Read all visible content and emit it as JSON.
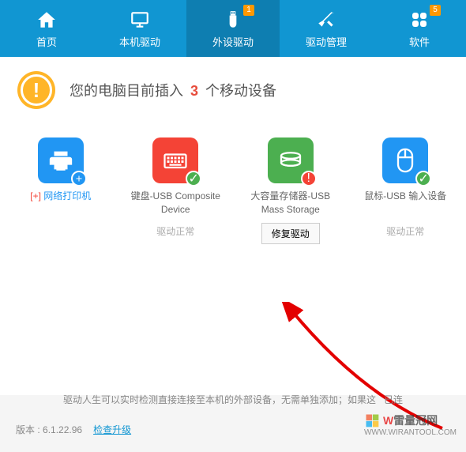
{
  "nav": {
    "items": [
      {
        "label": "首页",
        "badge": null
      },
      {
        "label": "本机驱动",
        "badge": null
      },
      {
        "label": "外设驱动",
        "badge": "1"
      },
      {
        "label": "驱动管理",
        "badge": null
      },
      {
        "label": "软件",
        "badge": "5"
      }
    ]
  },
  "alert": {
    "prefix": "您的电脑目前插入 ",
    "count": "3",
    "suffix": " 个移动设备"
  },
  "devices": [
    {
      "name": "网络打印机",
      "status": "",
      "action": ""
    },
    {
      "name": "键盘-USB Composite Device",
      "status": "驱动正常",
      "action": ""
    },
    {
      "name": "大容量存储器-USB Mass Storage",
      "status": "",
      "action": "修复驱动"
    },
    {
      "name": "鼠标-USB 输入设备",
      "status": "驱动正常",
      "action": ""
    }
  ],
  "footer": {
    "tip": "驱动人生可以实时检测直接连接至本机的外部设备，无需单独添加；如果这",
    "tip_suffix": "已连",
    "version_label": "版本 : ",
    "version": "6.1.22.96",
    "check": "检查升级"
  },
  "watermark": {
    "brand_prefix": "W",
    "brand": "雷量冠网",
    "url": "WWW.WIRANTOOL.COM"
  }
}
